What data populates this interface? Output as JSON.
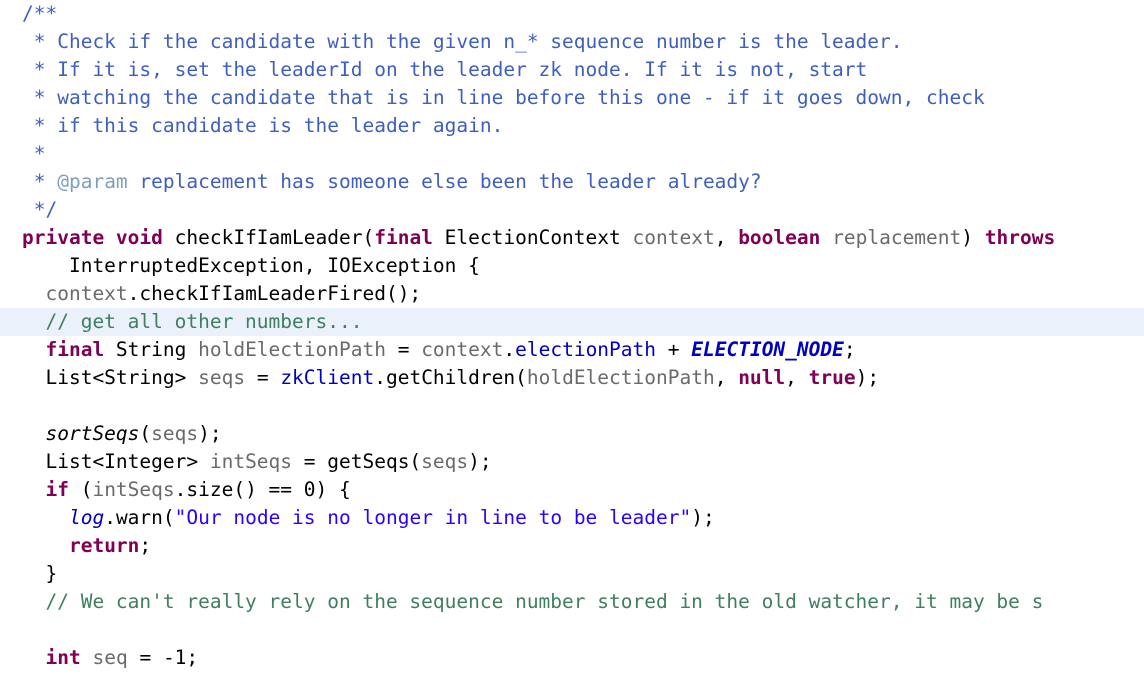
{
  "editor": {
    "language": "java",
    "background_color": "#ffffff",
    "current_line_highlight_color": "#eaf1fb",
    "colors": {
      "javadoc": "#3f5fbf",
      "javadoc_tag": "#7f9fbf",
      "line_comment": "#3f7f5f",
      "keyword": "#7f0055",
      "string": "#2a00ff",
      "local_variable": "#6a6a6a",
      "field": "#0000c0",
      "static_field": "#0000c0",
      "plain_text": "#000000"
    },
    "lines": [
      {
        "id": "line-01",
        "indent": 0,
        "highlighted": false,
        "tokens": [
          {
            "cls": "tok-javadoc",
            "text": "/**"
          }
        ]
      },
      {
        "id": "line-02",
        "indent": 0,
        "highlighted": false,
        "tokens": [
          {
            "cls": "tok-javadoc",
            "text": " * Check if the candidate with the given n_* sequence number is the leader."
          }
        ]
      },
      {
        "id": "line-03",
        "indent": 0,
        "highlighted": false,
        "tokens": [
          {
            "cls": "tok-javadoc",
            "text": " * If it is, set the leaderId on the leader zk node. If it is not, start"
          }
        ]
      },
      {
        "id": "line-04",
        "indent": 0,
        "highlighted": false,
        "tokens": [
          {
            "cls": "tok-javadoc",
            "text": " * watching the candidate that is in line before this one - if it goes down, check"
          }
        ]
      },
      {
        "id": "line-05",
        "indent": 0,
        "highlighted": false,
        "tokens": [
          {
            "cls": "tok-javadoc",
            "text": " * if this candidate is the leader again."
          }
        ]
      },
      {
        "id": "line-06",
        "indent": 0,
        "highlighted": false,
        "tokens": [
          {
            "cls": "tok-javadoc",
            "text": " *"
          }
        ]
      },
      {
        "id": "line-07",
        "indent": 0,
        "highlighted": false,
        "tokens": [
          {
            "cls": "tok-javadoc",
            "text": " * "
          },
          {
            "cls": "tok-javadoc-tag",
            "text": "@param"
          },
          {
            "cls": "tok-javadoc",
            "text": " replacement has someone else been the leader already?"
          }
        ]
      },
      {
        "id": "line-08",
        "indent": 0,
        "highlighted": false,
        "tokens": [
          {
            "cls": "tok-javadoc",
            "text": " */"
          }
        ]
      },
      {
        "id": "line-09",
        "indent": 0,
        "highlighted": false,
        "tokens": [
          {
            "cls": "tok-keyword",
            "text": "private void"
          },
          {
            "cls": "tok-plain",
            "text": " checkIfIamLeader("
          },
          {
            "cls": "tok-keyword",
            "text": "final"
          },
          {
            "cls": "tok-plain",
            "text": " ElectionContext "
          },
          {
            "cls": "tok-local",
            "text": "context"
          },
          {
            "cls": "tok-plain",
            "text": ", "
          },
          {
            "cls": "tok-keyword",
            "text": "boolean"
          },
          {
            "cls": "tok-plain",
            "text": " "
          },
          {
            "cls": "tok-local",
            "text": "replacement"
          },
          {
            "cls": "tok-plain",
            "text": ") "
          },
          {
            "cls": "tok-keyword",
            "text": "throws"
          }
        ]
      },
      {
        "id": "line-10",
        "indent": 0,
        "highlighted": false,
        "tokens": [
          {
            "cls": "tok-plain",
            "text": "    InterruptedException, IOException {"
          }
        ]
      },
      {
        "id": "line-11",
        "indent": 0,
        "highlighted": false,
        "tokens": [
          {
            "cls": "tok-local",
            "text": "  context"
          },
          {
            "cls": "tok-plain",
            "text": ".checkIfIamLeaderFired();"
          }
        ]
      },
      {
        "id": "line-12",
        "indent": 0,
        "highlighted": true,
        "tokens": [
          {
            "cls": "tok-comment",
            "text": "  // get all other numbers..."
          }
        ]
      },
      {
        "id": "line-13",
        "indent": 0,
        "highlighted": false,
        "tokens": [
          {
            "cls": "tok-plain",
            "text": "  "
          },
          {
            "cls": "tok-keyword",
            "text": "final"
          },
          {
            "cls": "tok-plain",
            "text": " String "
          },
          {
            "cls": "tok-local",
            "text": "holdElectionPath"
          },
          {
            "cls": "tok-plain",
            "text": " = "
          },
          {
            "cls": "tok-local",
            "text": "context"
          },
          {
            "cls": "tok-plain",
            "text": "."
          },
          {
            "cls": "tok-field",
            "text": "electionPath"
          },
          {
            "cls": "tok-plain",
            "text": " + "
          },
          {
            "cls": "tok-staticfield",
            "text": "ELECTION_NODE"
          },
          {
            "cls": "tok-plain",
            "text": ";"
          }
        ]
      },
      {
        "id": "line-14",
        "indent": 0,
        "highlighted": false,
        "tokens": [
          {
            "cls": "tok-plain",
            "text": "  List<String> "
          },
          {
            "cls": "tok-local",
            "text": "seqs"
          },
          {
            "cls": "tok-plain",
            "text": " = "
          },
          {
            "cls": "tok-field",
            "text": "zkClient"
          },
          {
            "cls": "tok-plain",
            "text": ".getChildren("
          },
          {
            "cls": "tok-local",
            "text": "holdElectionPath"
          },
          {
            "cls": "tok-plain",
            "text": ", "
          },
          {
            "cls": "tok-keyword",
            "text": "null"
          },
          {
            "cls": "tok-plain",
            "text": ", "
          },
          {
            "cls": "tok-keyword",
            "text": "true"
          },
          {
            "cls": "tok-plain",
            "text": ");"
          }
        ]
      },
      {
        "id": "line-15",
        "indent": 0,
        "highlighted": false,
        "tokens": [
          {
            "cls": "tok-plain",
            "text": ""
          }
        ]
      },
      {
        "id": "line-16",
        "indent": 0,
        "highlighted": false,
        "tokens": [
          {
            "cls": "tok-plain",
            "text": "  "
          },
          {
            "cls": "tok-staticmethod",
            "text": "sortSeqs"
          },
          {
            "cls": "tok-plain",
            "text": "("
          },
          {
            "cls": "tok-local",
            "text": "seqs"
          },
          {
            "cls": "tok-plain",
            "text": ");"
          }
        ]
      },
      {
        "id": "line-17",
        "indent": 0,
        "highlighted": false,
        "tokens": [
          {
            "cls": "tok-plain",
            "text": "  List<Integer> "
          },
          {
            "cls": "tok-local",
            "text": "intSeqs"
          },
          {
            "cls": "tok-plain",
            "text": " = getSeqs("
          },
          {
            "cls": "tok-local",
            "text": "seqs"
          },
          {
            "cls": "tok-plain",
            "text": ");"
          }
        ]
      },
      {
        "id": "line-18",
        "indent": 0,
        "highlighted": false,
        "tokens": [
          {
            "cls": "tok-plain",
            "text": "  "
          },
          {
            "cls": "tok-keyword",
            "text": "if"
          },
          {
            "cls": "tok-plain",
            "text": " ("
          },
          {
            "cls": "tok-local",
            "text": "intSeqs"
          },
          {
            "cls": "tok-plain",
            "text": ".size() == "
          },
          {
            "cls": "tok-number",
            "text": "0"
          },
          {
            "cls": "tok-plain",
            "text": ") {"
          }
        ]
      },
      {
        "id": "line-19",
        "indent": 0,
        "highlighted": false,
        "tokens": [
          {
            "cls": "tok-plain",
            "text": "    "
          },
          {
            "cls": "tok-staticfield-plain",
            "text": "log"
          },
          {
            "cls": "tok-plain",
            "text": ".warn("
          },
          {
            "cls": "tok-string",
            "text": "\"Our node is no longer in line to be leader\""
          },
          {
            "cls": "tok-plain",
            "text": ");"
          }
        ]
      },
      {
        "id": "line-20",
        "indent": 0,
        "highlighted": false,
        "tokens": [
          {
            "cls": "tok-plain",
            "text": "    "
          },
          {
            "cls": "tok-keyword",
            "text": "return"
          },
          {
            "cls": "tok-plain",
            "text": ";"
          }
        ]
      },
      {
        "id": "line-21",
        "indent": 0,
        "highlighted": false,
        "tokens": [
          {
            "cls": "tok-plain",
            "text": "  }"
          }
        ]
      },
      {
        "id": "line-22",
        "indent": 0,
        "highlighted": false,
        "tokens": [
          {
            "cls": "tok-comment",
            "text": "  // We can't really rely on the sequence number stored in the old watcher, it may be s"
          }
        ]
      },
      {
        "id": "line-23",
        "indent": 0,
        "highlighted": false,
        "tokens": [
          {
            "cls": "tok-plain",
            "text": ""
          }
        ]
      },
      {
        "id": "line-24",
        "indent": 0,
        "highlighted": false,
        "tokens": [
          {
            "cls": "tok-plain",
            "text": "  "
          },
          {
            "cls": "tok-keyword",
            "text": "int"
          },
          {
            "cls": "tok-plain",
            "text": " "
          },
          {
            "cls": "tok-local",
            "text": "seq"
          },
          {
            "cls": "tok-plain",
            "text": " = "
          },
          {
            "cls": "tok-number",
            "text": "-1"
          },
          {
            "cls": "tok-plain",
            "text": ";"
          }
        ]
      }
    ]
  }
}
